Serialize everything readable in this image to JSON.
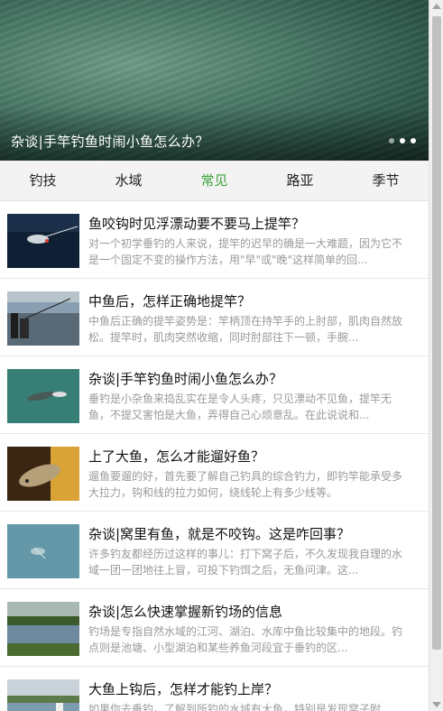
{
  "banner": {
    "caption": "杂谈|手竿钓鱼时闹小鱼怎么办？",
    "dots": 3,
    "active_dot": 2
  },
  "tabs": [
    {
      "label": "钓技",
      "active": false
    },
    {
      "label": "水域",
      "active": false
    },
    {
      "label": "常见",
      "active": true
    },
    {
      "label": "路亚",
      "active": false
    },
    {
      "label": "季节",
      "active": false
    }
  ],
  "articles": [
    {
      "title": "鱼咬钩时见浮漂动要不要马上提竿？",
      "summary": "对一个初学垂钓的人来说，提竿的迟早的确是一大难题，因为它不是一个固定不变的操作方法，用\"早\"或\"晚\"这样简单的回..."
    },
    {
      "title": "中鱼后，怎样正确地提竿？",
      "summary": "中鱼后正确的提竿姿势是：竿柄顶在持竿手的上肘部，肌肉自然放松。提竿时，肌肉突然收缩，同时肘部往下一顿，手腕..."
    },
    {
      "title": "杂谈|手竿钓鱼时闹小鱼怎么办？",
      "summary": "垂钓是小杂鱼来捣乱实在是令人头疼，只见漂动不见鱼，提竿无鱼，不提又害怕是大鱼，弄得自己心烦意乱。在此说说和..."
    },
    {
      "title": "上了大鱼，怎么才能遛好鱼？",
      "summary": "遛鱼要遛的好，首先要了解自己钓具的综合钓力，即钓竿能承受多大拉力，钩和线的拉力如何，绕线轮上有多少线等。"
    },
    {
      "title": "杂谈|窝里有鱼，就是不咬钩。这是咋回事？",
      "summary": "许多钓友都经历过这样的事儿：打下窝子后，不久发现我自理的水域一团一团地往上冒，可投下钓饵之后，无鱼问津。这..."
    },
    {
      "title": "杂谈|怎么快速掌握新钓场的信息",
      "summary": "钓场是专指自然水域的江河、湖泊、水库中鱼比较集中的地段。钓点则是池塘、小型湖泊和某些养鱼河段宜于垂钓的区..."
    },
    {
      "title": "大鱼上钩后，怎样才能钓上岸？",
      "summary": "如果你去垂钓，了解到所钓的水域有大鱼，特别是发现窝子附"
    }
  ]
}
